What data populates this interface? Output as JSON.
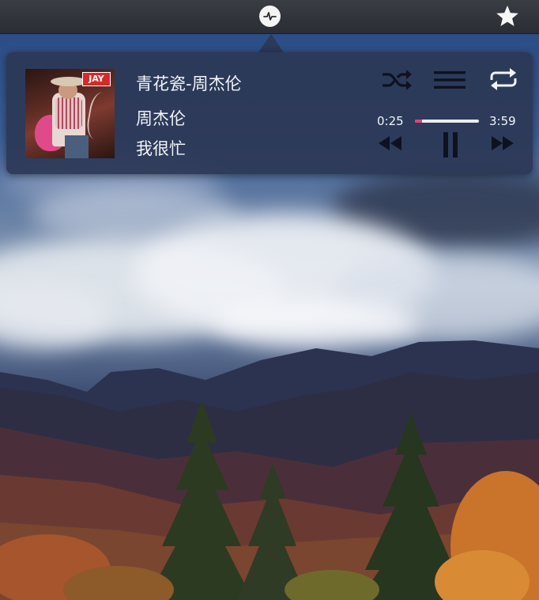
{
  "menubar": {
    "status_icon": "waveform-icon",
    "favorite_icon": "star-icon"
  },
  "player": {
    "title": "青花瓷-周杰伦",
    "artist": "周杰伦",
    "album": "我很忙",
    "album_badge": "JAY",
    "time_elapsed": "0:25",
    "time_total": "3:59",
    "progress": 0.105,
    "controls": {
      "shuffle_icon": "shuffle-icon",
      "playlist_icon": "list-icon",
      "repeat_icon": "repeat-icon",
      "rewind_icon": "rewind-icon",
      "pause_icon": "pause-icon",
      "forward_icon": "fast-forward-icon"
    }
  },
  "colors": {
    "accent": "#e0457a",
    "popover_bg": "#2c3856",
    "text": "#f2f4f8",
    "control_icon": "#0e1220"
  }
}
